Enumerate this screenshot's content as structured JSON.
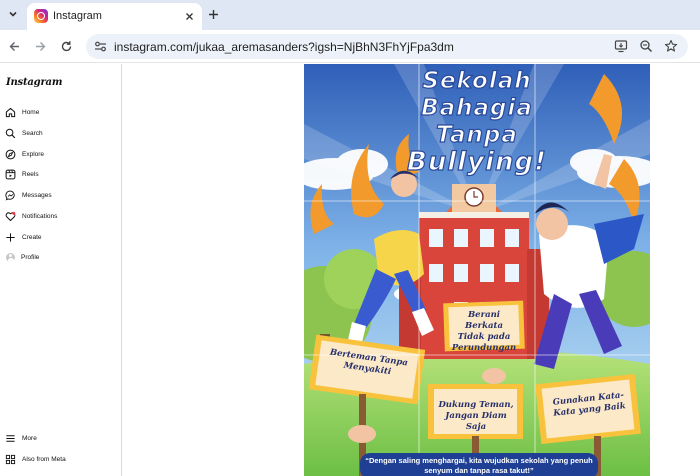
{
  "browser": {
    "tab_title": "Instagram",
    "url_host": "instagram.com",
    "url_path": "/jukaa_aremasanders?igsh=NjBhN3FhYjFpa3dm"
  },
  "sidebar": {
    "logo": "Instagram",
    "items": [
      {
        "label": "Home",
        "icon": "home-icon"
      },
      {
        "label": "Search",
        "icon": "search-icon"
      },
      {
        "label": "Explore",
        "icon": "compass-icon"
      },
      {
        "label": "Reels",
        "icon": "reels-icon"
      },
      {
        "label": "Messages",
        "icon": "messenger-icon"
      },
      {
        "label": "Notifications",
        "icon": "heart-icon"
      },
      {
        "label": "Create",
        "icon": "plus-icon"
      },
      {
        "label": "Profile",
        "icon": "profile-icon"
      }
    ],
    "bottom_items": [
      {
        "label": "More",
        "icon": "hamburger-icon"
      },
      {
        "label": "Also from Meta",
        "icon": "meta-icon"
      }
    ]
  },
  "post": {
    "title_lines": [
      "Sekolah",
      "Bahagia",
      "Tanpa",
      "Bullying!"
    ],
    "signs": [
      {
        "text": "Berani Berkata Tidak pada Perundungan"
      },
      {
        "text": "Berteman Tanpa Menyakiti"
      },
      {
        "text": "Dukung Teman, Jangan Diam Saja"
      },
      {
        "text": "Gunakan Kata-Kata yang Baik"
      }
    ],
    "caption": "“Dengan saling menghargai, kita wujudkan sekolah yang penuh senyum dan tanpa rasa takut!”"
  },
  "colors": {
    "tabbar": "#dfe6f4",
    "omnibox": "#edf2fa",
    "notification_accent": "#ff3040",
    "poster_sky": "#2f5fb8",
    "school_brick": "#d9443b",
    "caption_bg": "#1e3f93"
  }
}
